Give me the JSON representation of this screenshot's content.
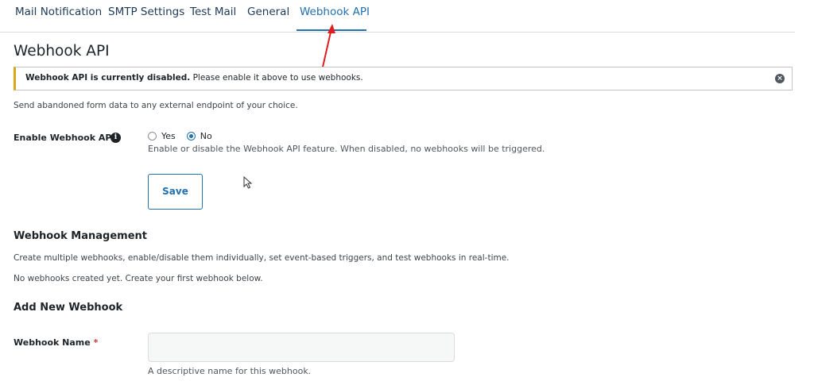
{
  "tabs": [
    {
      "label": "Mail Notification"
    },
    {
      "label": "SMTP Settings"
    },
    {
      "label": "Test Mail"
    },
    {
      "label": "General"
    },
    {
      "label": "Webhook API",
      "active": true
    }
  ],
  "page_title": "Webhook API",
  "notice": {
    "bold": "Webhook API is currently disabled.",
    "text": " Please enable it above to use webhooks.",
    "dismiss_icon": "close-circle-icon",
    "accent_color": "#dba617"
  },
  "description": "Send abandoned form data to any external endpoint of your choice.",
  "enable_webhook": {
    "label": "Enable Webhook API",
    "info_icon": "info-icon",
    "options": [
      {
        "label": "Yes",
        "checked": false
      },
      {
        "label": "No",
        "checked": true
      }
    ],
    "help": "Enable or disable the Webhook API feature. When disabled, no webhooks will be triggered."
  },
  "save_label": "Save",
  "management": {
    "title": "Webhook Management",
    "desc": "Create multiple webhooks, enable/disable them individually, set event-based triggers, and test webhooks in real-time.",
    "empty": "No webhooks created yet. Create your first webhook below."
  },
  "add_new": {
    "title": "Add New Webhook",
    "name_label": "Webhook Name",
    "required_mark": "*",
    "name_value": "",
    "name_help": "A descriptive name for this webhook."
  },
  "colors": {
    "accent": "#2271b1",
    "annotation_arrow": "#e01e1e"
  }
}
